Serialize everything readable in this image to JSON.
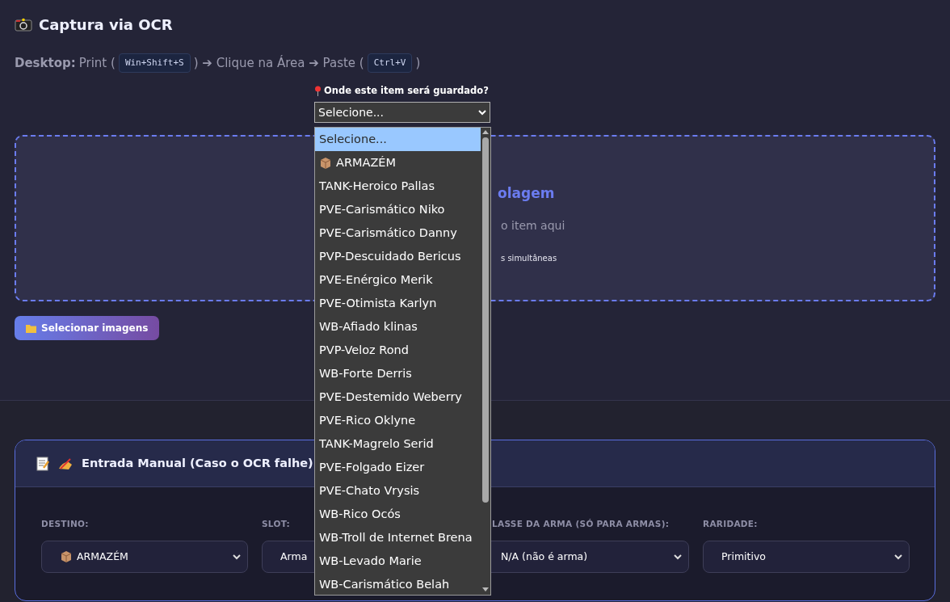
{
  "header": {
    "title": "Captura via OCR",
    "instructions": [
      {
        "kind": "label",
        "text": "Desktop:"
      },
      {
        "kind": "text",
        "text": "Print ("
      },
      {
        "kind": "key",
        "text": "Win+Shift+S"
      },
      {
        "kind": "text",
        "text": ") ➔ Clique na Área ➔ Paste ("
      },
      {
        "kind": "key",
        "text": "Ctrl+V"
      },
      {
        "kind": "text",
        "text": ")"
      }
    ]
  },
  "location": {
    "label": "Onde este item será guardado?",
    "value": "Selecione...",
    "expanded": true,
    "options": [
      {
        "label": "Selecione...",
        "kind": "placeholder",
        "selected": true
      },
      {
        "label": "ARMAZÉM",
        "kind": "storage",
        "selected": false
      },
      {
        "label": "TANK-Heroico Pallas",
        "kind": "character",
        "selected": false
      },
      {
        "label": "PVE-Carismático Niko",
        "kind": "character",
        "selected": false
      },
      {
        "label": "PVE-Carismático Danny",
        "kind": "character",
        "selected": false
      },
      {
        "label": "PVP-Descuidado Bericus",
        "kind": "character",
        "selected": false
      },
      {
        "label": "PVE-Enérgico Merik",
        "kind": "character",
        "selected": false
      },
      {
        "label": "PVE-Otimista Karlyn",
        "kind": "character",
        "selected": false
      },
      {
        "label": "WB-Afiado klinas",
        "kind": "character",
        "selected": false
      },
      {
        "label": "PVP-Veloz Rond",
        "kind": "character",
        "selected": false
      },
      {
        "label": "WB-Forte Derris",
        "kind": "character",
        "selected": false
      },
      {
        "label": "PVE-Destemido Weberry",
        "kind": "character",
        "selected": false
      },
      {
        "label": "PVE-Rico Oklyne",
        "kind": "character",
        "selected": false
      },
      {
        "label": "TANK-Magrelo Serid",
        "kind": "character",
        "selected": false
      },
      {
        "label": "PVE-Folgado Eizer",
        "kind": "character",
        "selected": false
      },
      {
        "label": "PVE-Chato Vrysis",
        "kind": "character",
        "selected": false
      },
      {
        "label": "WB-Rico Ocós",
        "kind": "character",
        "selected": false
      },
      {
        "label": "WB-Troll de Internet Brena",
        "kind": "character",
        "selected": false
      },
      {
        "label": "WB-Levado Marie",
        "kind": "character",
        "selected": false
      },
      {
        "label": "WB-Carismático Belah",
        "kind": "character",
        "selected": false
      }
    ]
  },
  "drop_zone": {
    "title": "olagem",
    "subtitle": "o item aqui",
    "note": "s simultâneas"
  },
  "select_button": {
    "label": "Selecionar imagens"
  },
  "manual_entry": {
    "title": "Entrada Manual (Caso o OCR falhe)",
    "fields": [
      {
        "label": "DESTINO:",
        "value": "ARMAZÉM",
        "kind": "storage"
      },
      {
        "label": "SLOT:",
        "value": "Arma",
        "kind": "plain"
      },
      {
        "label": "LASSE DA ARMA (SÓ PARA ARMAS):",
        "value": "N/A (não é arma)",
        "kind": "plain"
      },
      {
        "label": "RARIDADE:",
        "value": "Primitivo",
        "kind": "plain"
      }
    ]
  }
}
